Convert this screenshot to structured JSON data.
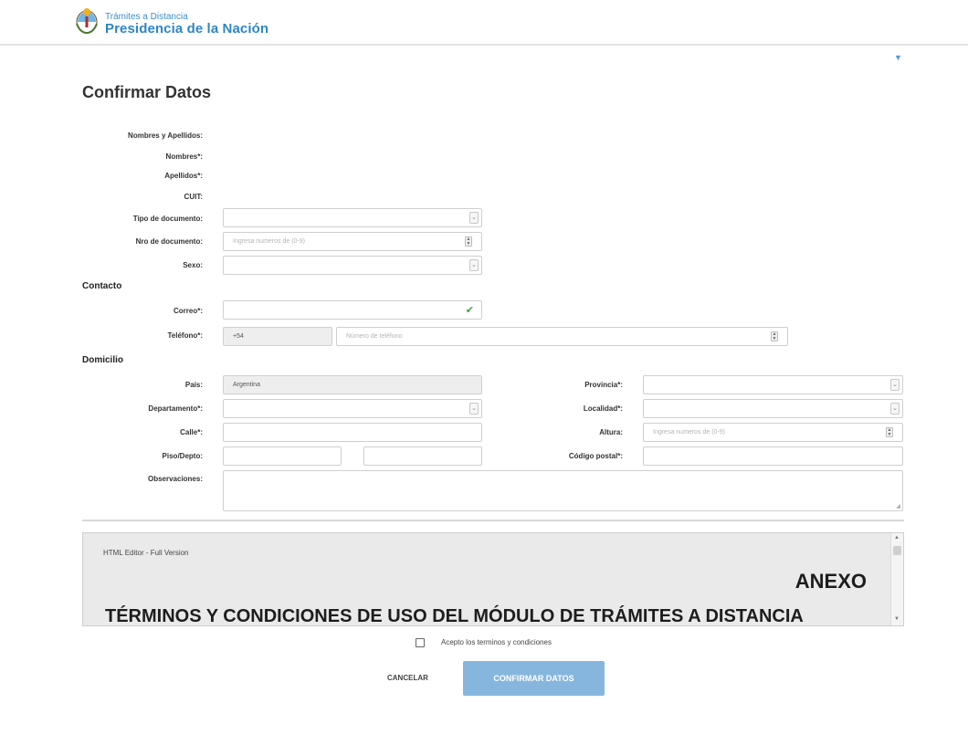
{
  "header": {
    "brand_top": "Trámites a Distancia",
    "brand_main": "Presidencia de la Nación",
    "logo_icon": "argentina-coat-of-arms-icon",
    "menu_caret_icon": "chevron-down-icon"
  },
  "page": {
    "title": "Confirmar Datos"
  },
  "personal": {
    "group_label": "Nombres y Apellidos:",
    "nombres_label": "Nombres*:",
    "apellidos_label": "Apellidos*:",
    "cuit_label": "CUIT:",
    "tipo_doc_label": "Tipo de documento:",
    "tipo_doc_value": "",
    "nro_doc_label": "Nro de documento:",
    "nro_doc_placeholder": "Ingresa numeros de (0-9)",
    "sexo_label": "Sexo:",
    "sexo_value": ""
  },
  "contacto": {
    "section_title": "Contacto",
    "correo_label": "Correo*:",
    "correo_value": "",
    "telefono_label": "Teléfono*:",
    "telefono_prefix": "+54",
    "telefono_placeholder": "Número de teléfono"
  },
  "domicilio": {
    "section_title": "Domicilio",
    "pais_label": "País:",
    "pais_value": "Argentina",
    "provincia_label": "Provincia*:",
    "departamento_label": "Departamento*:",
    "localidad_label": "Localidad*:",
    "calle_label": "Calle*:",
    "altura_label": "Altura:",
    "altura_placeholder": "Ingresa numeros de (0-9)",
    "piso_label": "Piso/Depto:",
    "codigo_postal_label": "Código postal*:",
    "observaciones_label": "Observaciones:"
  },
  "editor": {
    "label": "HTML Editor - Full Version",
    "anexo": "ANEXO",
    "terms_title": "TÉRMINOS Y CONDICIONES DE USO DEL MÓDULO DE TRÁMITES A DISTANCIA"
  },
  "footer": {
    "accept_label": "Acepto los terminos y condiciones",
    "accept_checked": false,
    "cancel_label": "CANCELAR",
    "confirm_label": "CONFIRMAR DATOS"
  },
  "colors": {
    "brand": "#2f86c3",
    "confirm_button": "#86b6de",
    "valid_check": "#38a53f",
    "disabled_field": "#eeeeee"
  }
}
